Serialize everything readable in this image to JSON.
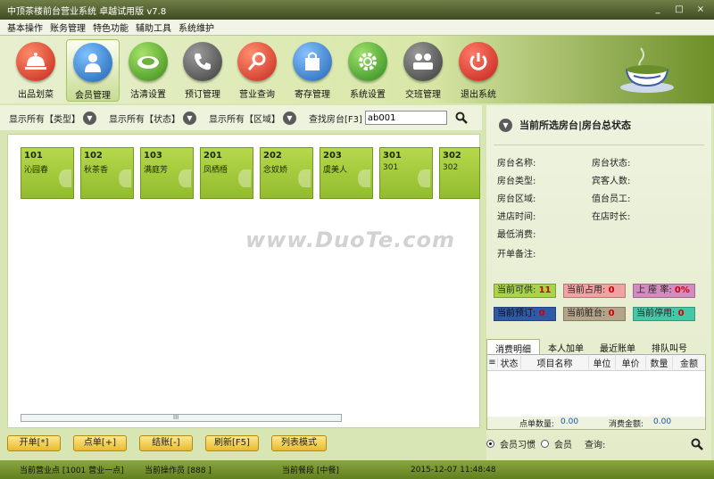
{
  "window": {
    "title": "中顶茶楼前台营业系统 卓越试用版 v7.8",
    "minimize": "_",
    "maximize": "□",
    "close": "×"
  },
  "menu": [
    "基本操作",
    "账务管理",
    "特色功能",
    "辅助工具",
    "系统维护"
  ],
  "toolbar": [
    {
      "label": "出品划菜",
      "icon": "serving-bell-icon",
      "color": "#d23a28"
    },
    {
      "label": "会员管理",
      "icon": "member-icon",
      "color": "#2e7fc8"
    },
    {
      "label": "沽清设置",
      "icon": "plate-icon",
      "color": "#4a9a22"
    },
    {
      "label": "预订管理",
      "icon": "phone-icon",
      "color": "#5a5a5a"
    },
    {
      "label": "营业查询",
      "icon": "search-icon",
      "color": "#d7382a"
    },
    {
      "label": "寄存管理",
      "icon": "bag-icon",
      "color": "#3578c4"
    },
    {
      "label": "系统设置",
      "icon": "gear-icon",
      "color": "#3f9b2a"
    },
    {
      "label": "交班管理",
      "icon": "team-icon",
      "color": "#555555"
    },
    {
      "label": "退出系统",
      "icon": "power-icon",
      "color": "#d42d22"
    }
  ],
  "filters": {
    "type_label": "显示所有【类型】",
    "status_label": "显示所有【状态】",
    "area_label": "显示所有【区域】",
    "search_label": "查找房台[F3]",
    "search_value": "ab001"
  },
  "rooms": [
    {
      "no": "101",
      "name": "沁园春"
    },
    {
      "no": "102",
      "name": "秋茶香"
    },
    {
      "no": "103",
      "name": "满庭芳"
    },
    {
      "no": "201",
      "name": "凤栖梧"
    },
    {
      "no": "202",
      "name": "念奴娇"
    },
    {
      "no": "203",
      "name": "虞美人"
    },
    {
      "no": "301",
      "name": "301"
    },
    {
      "no": "302",
      "name": "302"
    }
  ],
  "scroll_grip": "III",
  "watermark": "www.DuoTe.com",
  "bottom_buttons": [
    "开单[*]",
    "点单[+]",
    "结账[-]",
    "刷新[F5]",
    "列表模式"
  ],
  "status": {
    "point": "当前营业点 [1001 营业一点]",
    "operator": "当前操作员 [888 ]",
    "period": "当前餐段 [中餐]",
    "datetime": "2015-12-07 11:48:48"
  },
  "right": {
    "title": "当前所选房台|房台总状态",
    "fields": {
      "room_name": "房台名称:",
      "room_state": "房台状态:",
      "room_type": "房台类型:",
      "guests": "宾客人数:",
      "room_area": "房台区域:",
      "staff": "值台员工:",
      "checkin_time": "进店时间:",
      "stay_time": "在店时长:",
      "min_consume": "最低消费:",
      "note": "开单备注:"
    },
    "stats": [
      {
        "label": "当前可供:",
        "value": "11",
        "color": "#a9d44a"
      },
      {
        "label": "当前占用:",
        "value": "0",
        "color": "#f1a2a2"
      },
      {
        "label": "上 座 率:",
        "value": "0%",
        "color": "#d48cc0"
      },
      {
        "label": "当前预订:",
        "value": "0",
        "color": "#2f5aa8"
      },
      {
        "label": "当前脏台:",
        "value": "0",
        "color": "#b3a48a"
      },
      {
        "label": "当前停用:",
        "value": "0",
        "color": "#46c8a8"
      }
    ],
    "tabs": [
      "消费明细",
      "本人加单",
      "最近账单",
      "排队叫号"
    ],
    "columns": [
      "",
      "状态",
      "项目名称",
      "单位",
      "单价",
      "数量",
      "金额"
    ],
    "footer_qty_label": "点单数量:",
    "footer_qty": "0.00",
    "footer_amt_label": "消费金额:",
    "footer_amt": "0.00",
    "radio_1": "会员习惯",
    "radio_2": "会员",
    "query_label": "查询:"
  }
}
